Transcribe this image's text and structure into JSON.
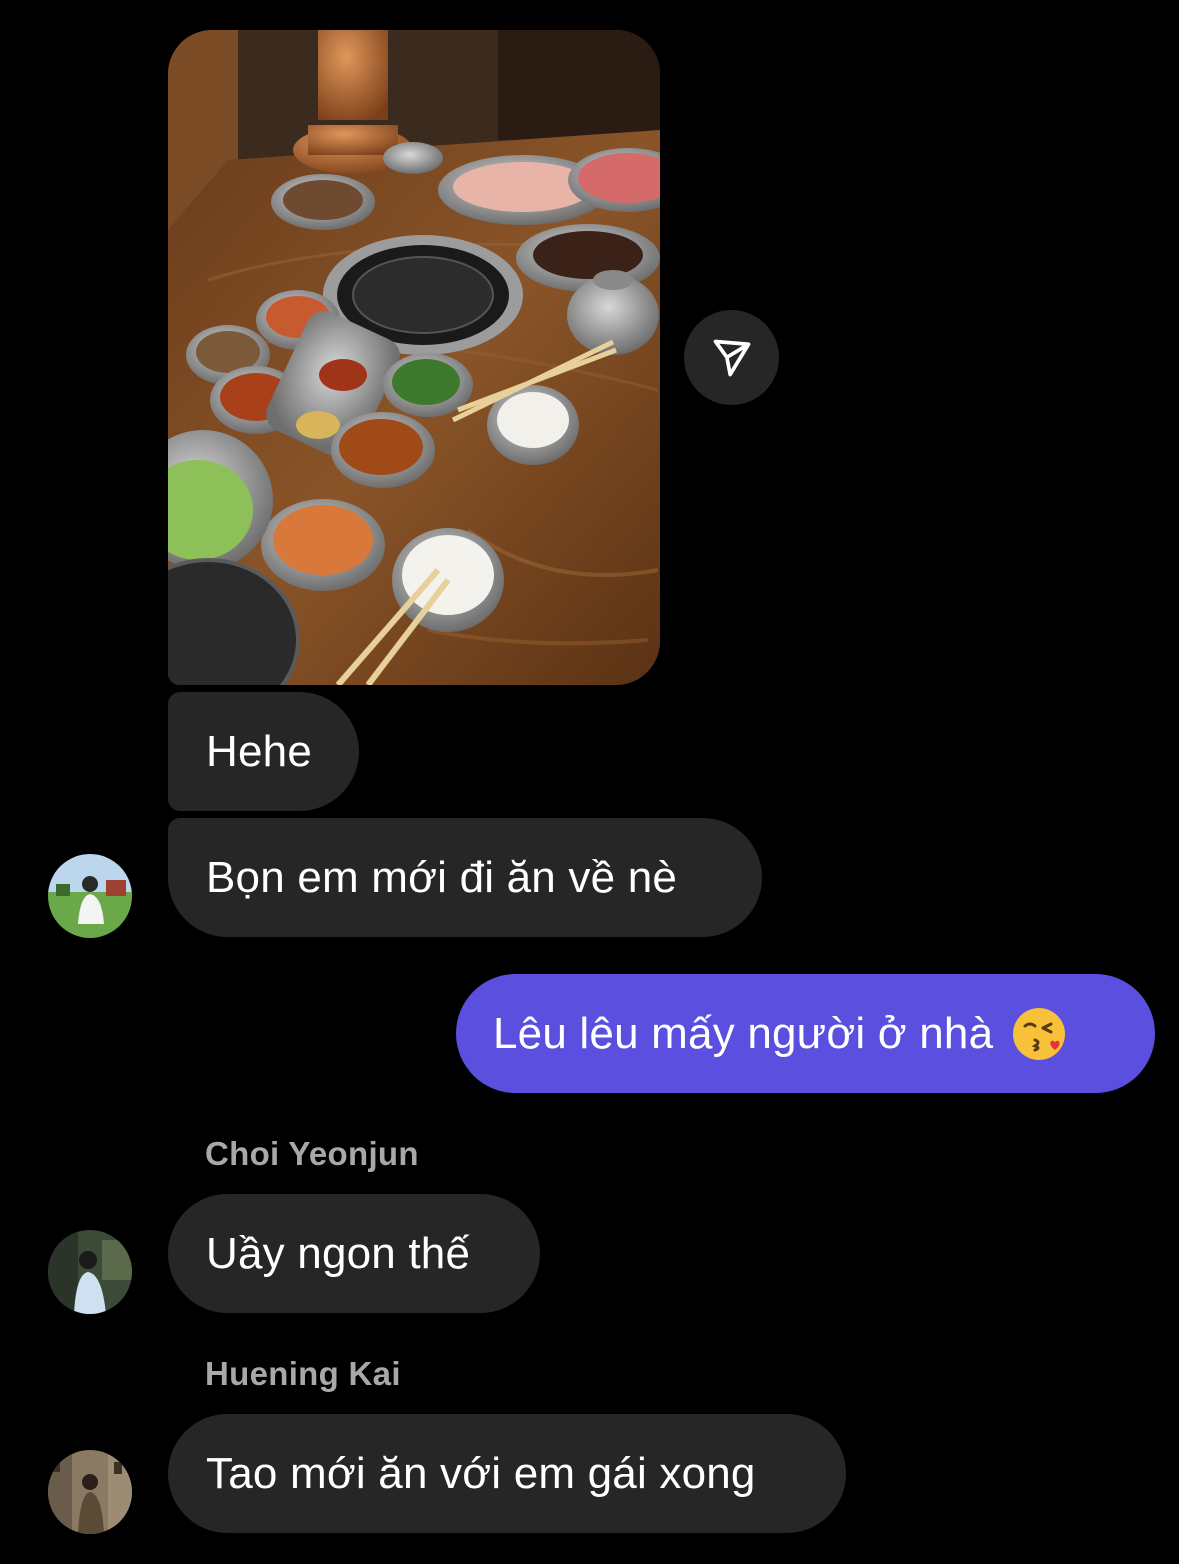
{
  "thread": {
    "photo_message": {
      "alt": "Korean BBQ table with grill, side dishes, rice bowls and chopsticks"
    },
    "share_button": {
      "icon": "paper-plane-icon"
    },
    "messages": [
      {
        "text": "Hehe",
        "direction": "incoming"
      },
      {
        "text": "Bọn em mới đi ăn về nè",
        "direction": "incoming"
      },
      {
        "text": "Lêu lêu mấy người ở nhà",
        "emoji": "face-blowing-kiss",
        "direction": "outgoing"
      },
      {
        "sender": "Choi Yeonjun",
        "text": "Uầy ngon thế",
        "direction": "incoming"
      },
      {
        "sender": "Huening Kai",
        "text": "Tao mới ăn với em gái xong",
        "direction": "incoming"
      }
    ]
  },
  "colors": {
    "background": "#000000",
    "incoming_bubble": "#262626",
    "outgoing_bubble": "#5b4fe0",
    "sender_name": "#a8a8a8"
  }
}
